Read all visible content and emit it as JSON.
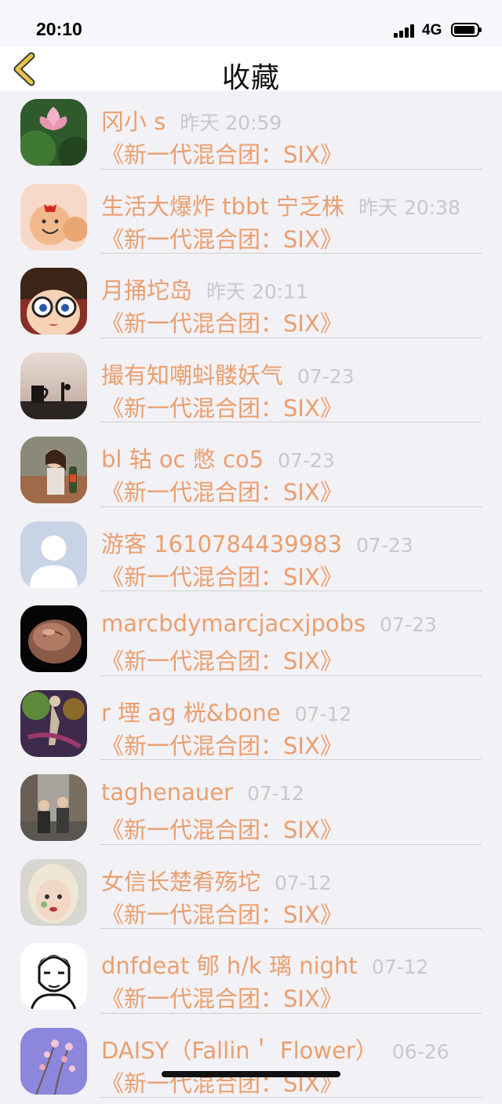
{
  "status_bar": {
    "time": "20:10",
    "network": "4G"
  },
  "nav": {
    "title": "收藏",
    "back_icon": "chevron-left-icon",
    "back_color": "#e8c34a"
  },
  "colors": {
    "accent": "#ea9f6e",
    "time_gray": "#c8c8c8",
    "background": "#f2f1f6"
  },
  "favorites": [
    {
      "name": "冈小 s",
      "time": "昨天 20:59",
      "title": "《新一代混合团：SIX》"
    },
    {
      "name": "生活大爆炸 tbbt 宁乏株",
      "time": "昨天 20:38",
      "title": "《新一代混合团：SIX》"
    },
    {
      "name": "月捅坨岛",
      "time": "昨天 20:11",
      "title": "《新一代混合团：SIX》"
    },
    {
      "name": "撮有知嘲蚪髅妖气",
      "time": "07-23",
      "title": "《新一代混合团：SIX》"
    },
    {
      "name": "bl 轱 oc 憋 co5",
      "time": "07-23",
      "title": "《新一代混合团：SIX》"
    },
    {
      "name": "游客 1610784439983",
      "time": "07-23",
      "title": "《新一代混合团：SIX》"
    },
    {
      "name": "marcbdymarcjacxjpobs",
      "time": "07-23",
      "title": "《新一代混合团：SIX》"
    },
    {
      "name": "r 堙 ag 桄&bone",
      "time": "07-12",
      "title": "《新一代混合团：SIX》"
    },
    {
      "name": "taghenauer",
      "time": "07-12",
      "title": "《新一代混合团：SIX》"
    },
    {
      "name": "女信长楚肴殇坨",
      "time": "07-12",
      "title": "《新一代混合团：SIX》"
    },
    {
      "name": "dnfdeat 郇 h/k 璃 night",
      "time": "07-12",
      "title": "《新一代混合团：SIX》"
    },
    {
      "name": "DAISY（Fallin＇ Flower）",
      "time": "06-26",
      "title": "《新一代混合团：SIX》"
    }
  ]
}
